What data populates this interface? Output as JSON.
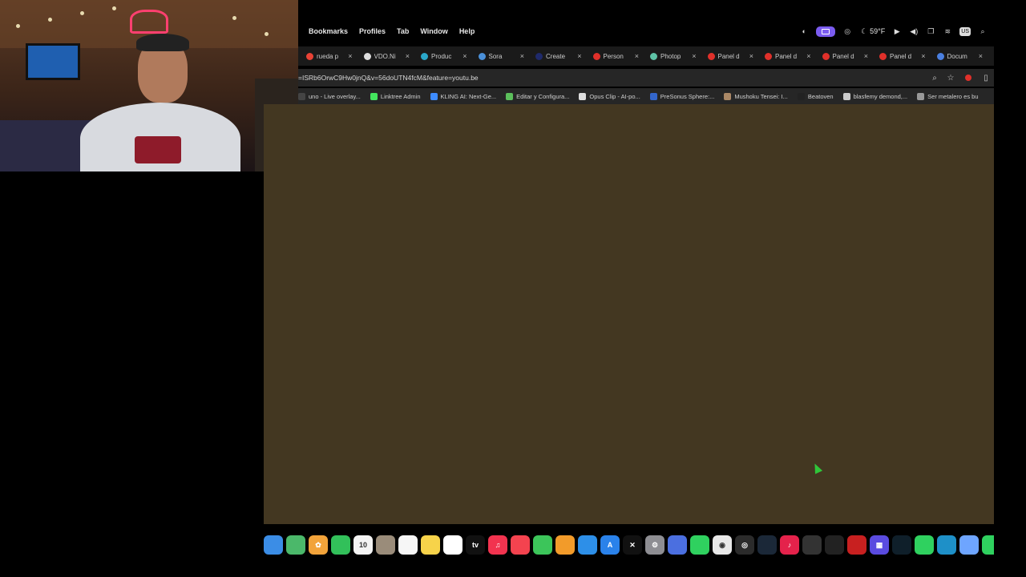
{
  "menubar": {
    "menus": [
      "Bookmarks",
      "Profiles",
      "Tab",
      "Window",
      "Help"
    ],
    "weather": "59°F",
    "input_source": "US"
  },
  "tabs": [
    {
      "label": "rueda p",
      "color": "#e94235"
    },
    {
      "label": "VDO.Ni",
      "color": "#dddddd"
    },
    {
      "label": "Produc",
      "color": "#2aa7c9"
    },
    {
      "label": "Sora",
      "color": "#4a90d9"
    },
    {
      "label": "Create",
      "color": "#1f2a6b"
    },
    {
      "label": "Person",
      "color": "#e0302a"
    },
    {
      "label": "Photop",
      "color": "#5ec2a6"
    },
    {
      "label": "Panel d",
      "color": "#e0302a"
    },
    {
      "label": "Panel d",
      "color": "#e0302a"
    },
    {
      "label": "Panel d",
      "color": "#e0302a"
    },
    {
      "label": "Panel d",
      "color": "#e0302a"
    },
    {
      "label": "Docum",
      "color": "#4a7fe0"
    }
  ],
  "address": {
    "url": "=ISRb6OrwC9Hw0jnQ&v=56doUTN4fcM&feature=youtu.be"
  },
  "bookmarks": [
    {
      "label": "uno - Live overlay...",
      "color": "#444444"
    },
    {
      "label": "Linktree Admin",
      "color": "#43e55e"
    },
    {
      "label": "KLING AI: Next-Ge...",
      "color": "#3d8bff"
    },
    {
      "label": "Editar y Configura...",
      "color": "#5bbf5b"
    },
    {
      "label": "Opus Clip - AI-po...",
      "color": "#dddddd"
    },
    {
      "label": "PreSonus Sphere:...",
      "color": "#3366cc"
    },
    {
      "label": "Mushoku Tensei: I...",
      "color": "#aa8866"
    },
    {
      "label": "Beatoven",
      "color": "#222222"
    },
    {
      "label": "blasfemy demond,...",
      "color": "#cccccc"
    },
    {
      "label": "Ser metalero es bu",
      "color": "#999999"
    }
  ],
  "dock": {
    "items": [
      {
        "name": "finder-icon",
        "color": "#3b8de6",
        "glyph": ""
      },
      {
        "name": "maps-icon",
        "color": "#4bb86a",
        "glyph": ""
      },
      {
        "name": "photos-icon",
        "color": "#f2a33a",
        "glyph": "✿"
      },
      {
        "name": "facetime-icon",
        "color": "#32c05a",
        "glyph": ""
      },
      {
        "name": "calendar-icon",
        "color": "#f4f4f4",
        "glyph": "10"
      },
      {
        "name": "contacts-icon",
        "color": "#9a8c7a",
        "glyph": ""
      },
      {
        "name": "reminders-icon",
        "color": "#f6f6f6",
        "glyph": ""
      },
      {
        "name": "notes-icon",
        "color": "#f7d34a",
        "glyph": ""
      },
      {
        "name": "freeform-icon",
        "color": "#ffffff",
        "glyph": ""
      },
      {
        "name": "apple-tv-icon",
        "color": "#111111",
        "glyph": "tv"
      },
      {
        "name": "music-icon",
        "color": "#f2334f",
        "glyph": "♫"
      },
      {
        "name": "news-icon",
        "color": "#f4434f",
        "glyph": ""
      },
      {
        "name": "numbers-icon",
        "color": "#3cc55a",
        "glyph": ""
      },
      {
        "name": "pages-icon",
        "color": "#f29b2a",
        "glyph": ""
      },
      {
        "name": "keynote-icon",
        "color": "#2d8fe8",
        "glyph": ""
      },
      {
        "name": "app-store-icon",
        "color": "#2a82ea",
        "glyph": "A"
      },
      {
        "name": "capcut-icon",
        "color": "#111111",
        "glyph": "✕"
      },
      {
        "name": "system-settings-icon",
        "color": "#8e8e93",
        "glyph": "⚙"
      },
      {
        "name": "finder-window-icon",
        "color": "#4b6fe0",
        "glyph": ""
      },
      {
        "name": "whatsapp-icon",
        "color": "#2fd15f",
        "glyph": ""
      },
      {
        "name": "chrome-icon",
        "color": "#e8e8e8",
        "glyph": "◉"
      },
      {
        "name": "obs-icon",
        "color": "#2b2b2b",
        "glyph": "◎"
      },
      {
        "name": "steam-icon",
        "color": "#1b2838",
        "glyph": ""
      },
      {
        "name": "tiktok-icon",
        "color": "#e4224b",
        "glyph": "♪"
      },
      {
        "name": "final-cut-icon",
        "color": "#333333",
        "glyph": ""
      },
      {
        "name": "chatgpt-icon",
        "color": "#222222",
        "glyph": ""
      },
      {
        "name": "game-icon",
        "color": "#c82020",
        "glyph": ""
      },
      {
        "name": "launchpad-icon",
        "color": "#5a4be0",
        "glyph": "▦"
      },
      {
        "name": "audio-app-icon",
        "color": "#0f1f2a",
        "glyph": ""
      },
      {
        "name": "phone-icon",
        "color": "#2fd15f",
        "glyph": ""
      },
      {
        "name": "edge-icon",
        "color": "#1e90c8",
        "glyph": ""
      },
      {
        "name": "mail-icon",
        "color": "#6ea5ff",
        "glyph": ""
      },
      {
        "name": "messages-icon",
        "color": "#2fd15f",
        "glyph": ""
      }
    ]
  }
}
